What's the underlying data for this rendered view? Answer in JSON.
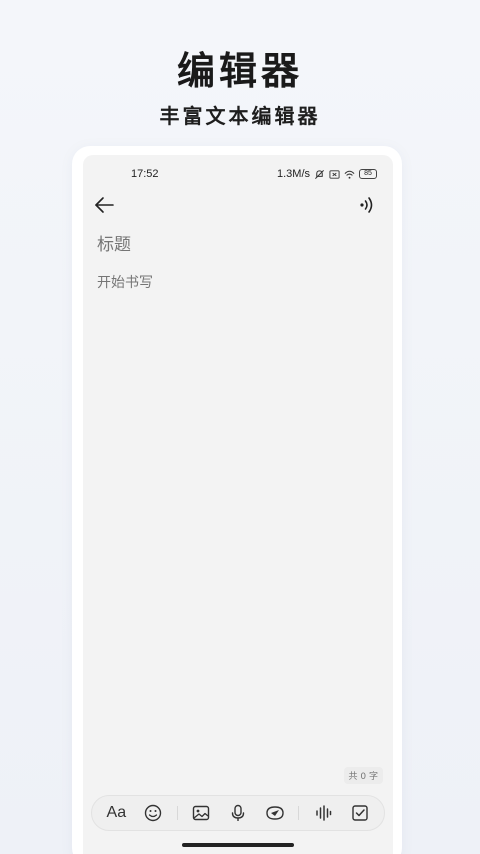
{
  "promo": {
    "title": "编辑器",
    "subtitle": "丰富文本编辑器"
  },
  "status_bar": {
    "time": "17:52",
    "network_speed": "1.3M/s",
    "battery": "85",
    "icons": [
      "mute-icon",
      "sim-x-icon",
      "wifi-icon",
      "battery-icon"
    ]
  },
  "editor": {
    "title_placeholder": "标题",
    "body_placeholder": "开始书写",
    "word_count": "共 0 字"
  },
  "toolbar": {
    "font_label": "Aa",
    "items": [
      "font-style",
      "emoji",
      "image",
      "voice",
      "doodle",
      "audio-wave",
      "checklist"
    ]
  }
}
